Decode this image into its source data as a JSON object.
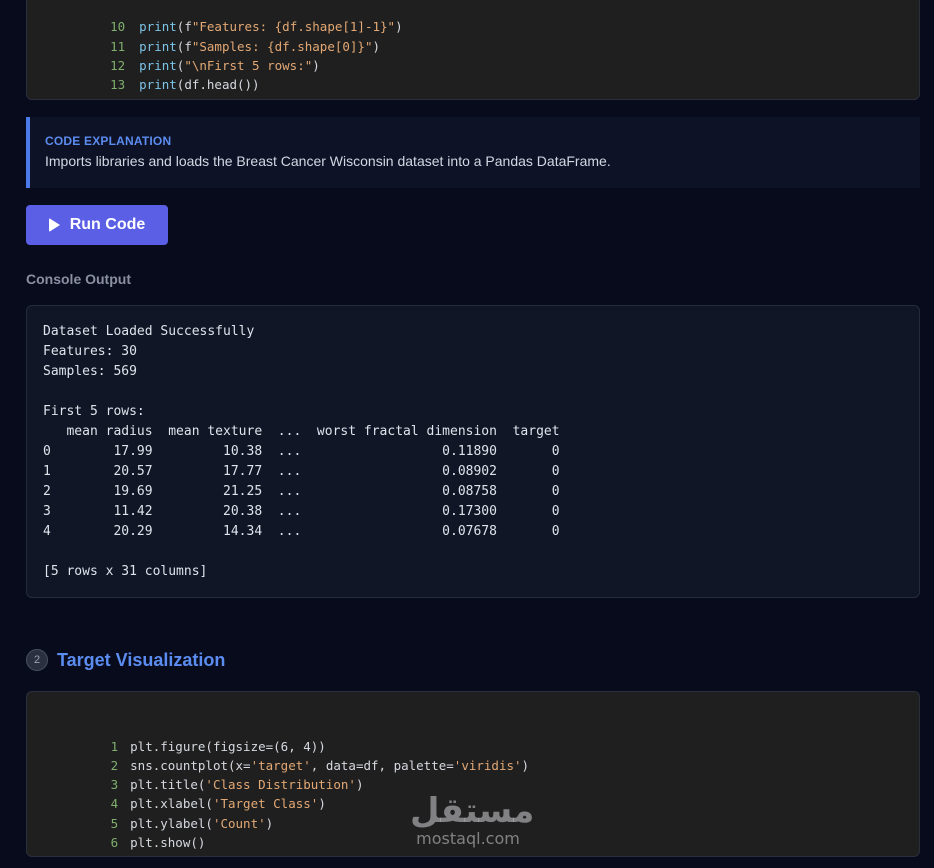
{
  "top_code": {
    "lines": [
      {
        "n": "10",
        "fn": "print",
        "rest_a": "(f",
        "str": "\"Features: {df.shape[1]-1}\"",
        "rest_b": ")"
      },
      {
        "n": "11",
        "fn": "print",
        "rest_a": "(f",
        "str": "\"Samples: {df.shape[0]}\"",
        "rest_b": ")"
      },
      {
        "n": "12",
        "fn": "print",
        "rest_a": "(",
        "str": "\"\\nFirst 5 rows:\"",
        "rest_b": ")"
      },
      {
        "n": "13",
        "fn": "print",
        "rest_a": "(df.head())",
        "str": "",
        "rest_b": ""
      }
    ]
  },
  "explanation": {
    "title": "CODE EXPLANATION",
    "body": "Imports libraries and loads the Breast Cancer Wisconsin dataset into a Pandas DataFrame."
  },
  "run_button": {
    "label": "Run Code",
    "icon": "play-icon",
    "color": "#5b5fe6"
  },
  "console": {
    "label": "Console Output",
    "output": "Dataset Loaded Successfully\nFeatures: 30\nSamples: 569\n\nFirst 5 rows:\n   mean radius  mean texture  ...  worst fractal dimension  target\n0        17.99         10.38  ...                  0.11890       0\n1        20.57         17.77  ...                  0.08902       0\n2        19.69         21.25  ...                  0.08758       0\n3        11.42         20.38  ...                  0.17300       0\n4        20.29         14.34  ...                  0.07678       0\n\n[5 rows x 31 columns]"
  },
  "section": {
    "number": "2",
    "title": "Target Visualization"
  },
  "bottom_code": {
    "lines": [
      {
        "n": "1",
        "parts": [
          {
            "t": "plt.figure(figsize=(6, 4))",
            "c": ""
          }
        ]
      },
      {
        "n": "2",
        "parts": [
          {
            "t": "sns.countplot(x=",
            "c": ""
          },
          {
            "t": "'target'",
            "c": "str"
          },
          {
            "t": ", data=df, palette=",
            "c": ""
          },
          {
            "t": "'viridis'",
            "c": "str"
          },
          {
            "t": ")",
            "c": ""
          }
        ]
      },
      {
        "n": "3",
        "parts": [
          {
            "t": "plt.title(",
            "c": ""
          },
          {
            "t": "'Class Distribution'",
            "c": "str"
          },
          {
            "t": ")",
            "c": ""
          }
        ]
      },
      {
        "n": "4",
        "parts": [
          {
            "t": "plt.xlabel(",
            "c": ""
          },
          {
            "t": "'Target Class'",
            "c": "str"
          },
          {
            "t": ")",
            "c": ""
          }
        ]
      },
      {
        "n": "5",
        "parts": [
          {
            "t": "plt.ylabel(",
            "c": ""
          },
          {
            "t": "'Count'",
            "c": "str"
          },
          {
            "t": ")",
            "c": ""
          }
        ]
      },
      {
        "n": "6",
        "parts": [
          {
            "t": "plt.show()",
            "c": ""
          }
        ]
      }
    ]
  },
  "watermark": {
    "arabic": "مستقل",
    "latin": "mostaql.com"
  },
  "colors": {
    "accent": "#5b8cf0",
    "background": "#070b1c",
    "line_number": "#7fae6d",
    "string": "#e3a874",
    "function": "#7cc4e8"
  }
}
